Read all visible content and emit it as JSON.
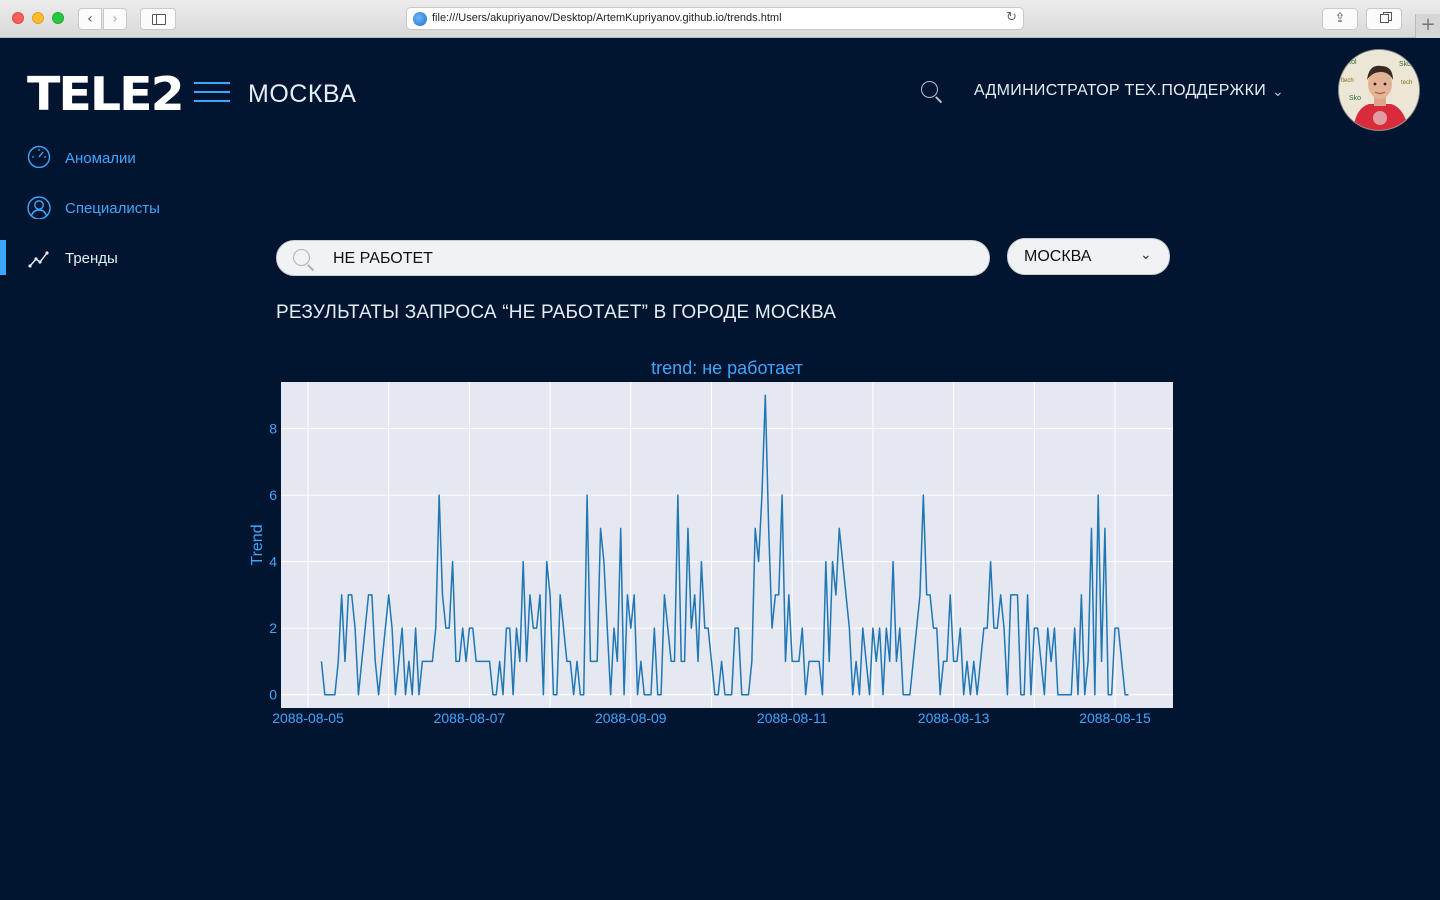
{
  "browser": {
    "url": "file:///Users/akupriyanov/Desktop/ArtemKupriyanov.github.io/trends.html",
    "back_icon": "chevron-left-icon",
    "forward_icon": "chevron-right-icon",
    "reload_icon": "reload-icon",
    "share_icon": "share-icon",
    "tabs_icon": "tabs-icon",
    "new_tab_icon": "plus-icon"
  },
  "header": {
    "logo": "TELE2",
    "city": "МОСКВА",
    "role": "АДМИНИСТРАТОР ТЕХ.ПОДДЕРЖКИ"
  },
  "nav": {
    "items": [
      {
        "label": "Аномалии",
        "icon": "speedometer-icon",
        "active": false
      },
      {
        "label": "Специалисты",
        "icon": "user-icon",
        "active": false
      },
      {
        "label": "Тренды",
        "icon": "trend-line-icon",
        "active": true
      }
    ]
  },
  "search": {
    "value": "НЕ РАБОТЕТ",
    "city_select": "МОСКВА"
  },
  "results": {
    "title": "РЕЗУЛЬТАТЫ ЗАПРОСА “НЕ РАБОТАЕТ” В ГОРОДЕ МОСКВА"
  },
  "colors": {
    "background": "#021530",
    "accent": "#3fa6ff",
    "plot_bg": "#e5e8f1",
    "line": "#1f77b4"
  },
  "chart_data": {
    "type": "line",
    "title": "trend: не работает",
    "xlabel": "",
    "ylabel": "Trend",
    "xtick_labels": [
      "2088-08-05",
      "2088-08-07",
      "2088-08-09",
      "2088-08-11",
      "2088-08-13",
      "2088-08-15"
    ],
    "x_start": "2088-08-05 04:00",
    "x_step_hours": 1,
    "ylim": [
      -0.4,
      9.4
    ],
    "yticks": [
      0,
      2,
      4,
      6,
      8
    ],
    "grid": true,
    "series": [
      {
        "values": [
          1,
          0,
          0,
          0,
          0,
          1,
          3,
          1,
          3,
          3,
          2,
          0,
          1,
          2,
          3,
          3,
          1,
          0,
          1,
          2,
          3,
          2,
          0,
          1,
          2,
          0,
          1,
          0,
          2,
          0,
          1,
          1,
          1,
          1,
          2,
          6,
          3,
          2,
          2,
          4,
          1,
          1,
          2,
          1,
          2,
          2,
          1,
          1,
          1,
          1,
          1,
          0,
          0,
          1,
          0,
          2,
          2,
          0,
          2,
          1,
          4,
          1,
          3,
          2,
          2,
          3,
          0,
          4,
          3,
          0,
          0,
          3,
          2,
          1,
          1,
          0,
          1,
          0,
          0,
          6,
          1,
          1,
          1,
          5,
          4,
          2,
          0,
          2,
          1,
          5,
          0,
          3,
          2,
          3,
          0,
          1,
          0,
          0,
          0,
          2,
          0,
          0,
          3,
          2,
          1,
          1,
          6,
          1,
          1,
          5,
          2,
          3,
          1,
          4,
          2,
          2,
          1,
          0,
          0,
          1,
          0,
          0,
          0,
          2,
          2,
          0,
          0,
          0,
          1,
          5,
          4,
          6,
          9,
          5,
          2,
          3,
          3,
          6,
          1,
          3,
          1,
          1,
          1,
          2,
          0,
          1,
          1,
          1,
          1,
          0,
          4,
          1,
          4,
          3,
          5,
          4,
          3,
          2,
          0,
          1,
          0,
          2,
          1,
          0,
          2,
          1,
          2,
          0,
          2,
          1,
          4,
          1,
          2,
          0,
          0,
          0,
          1,
          2,
          3,
          6,
          3,
          3,
          2,
          2,
          0,
          1,
          1,
          3,
          1,
          1,
          2,
          0,
          1,
          0,
          1,
          0,
          1,
          2,
          2,
          4,
          2,
          2,
          3,
          2,
          0,
          3,
          3,
          3,
          0,
          0,
          3,
          0,
          2,
          2,
          1,
          0,
          2,
          1,
          2,
          0,
          0,
          0,
          0,
          0,
          2,
          0,
          3,
          0,
          1,
          5,
          0,
          6,
          1,
          5,
          0,
          0,
          2,
          2,
          1,
          0,
          0
        ]
      }
    ]
  }
}
